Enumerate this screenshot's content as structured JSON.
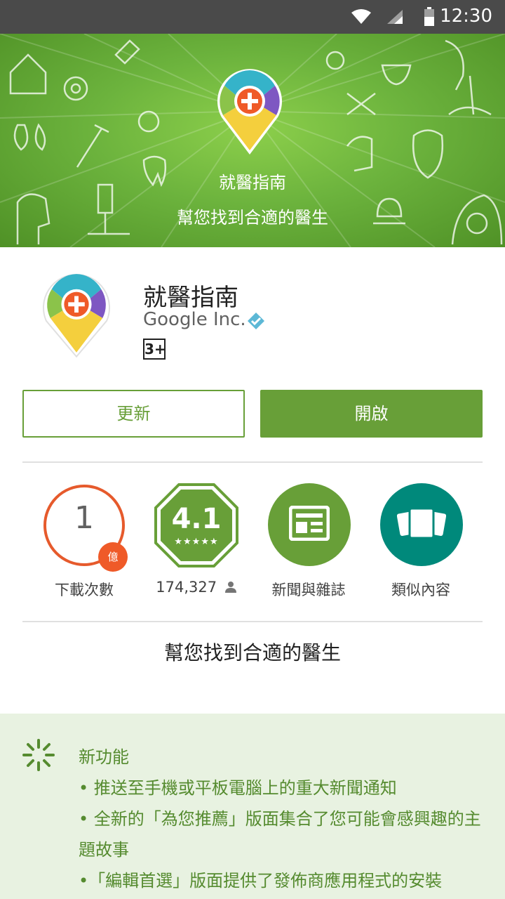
{
  "status_bar": {
    "time": "12:30"
  },
  "hero": {
    "title": "就醫指南",
    "subtitle": "幫您找到合適的醫生"
  },
  "app": {
    "name": "就醫指南",
    "developer": "Google Inc.",
    "content_rating": "3+"
  },
  "buttons": {
    "update": "更新",
    "open": "開啟"
  },
  "stats": {
    "downloads": {
      "value": "1",
      "unit": "億",
      "label": "下載次數"
    },
    "rating": {
      "value": "4.1",
      "stars": "★★★★★",
      "count": "174,327",
      "stars_value": 4.1
    },
    "category": {
      "label": "新聞與雜誌",
      "icon": "newspaper-icon"
    },
    "similar": {
      "label": "類似內容",
      "icon": "cards-icon"
    }
  },
  "tagline": "幫您找到合適的醫生",
  "whats_new": {
    "title": "新功能",
    "items": [
      "• 推送至手機或平板電腦上的重大新聞通知",
      "• 全新的「為您推薦」版面集合了您可能會感興趣的主題故事",
      "•「編輯首選」版面提供了發佈商應用程式的安裝"
    ]
  },
  "colors": {
    "accent": "#689f38",
    "downloads": "#e65a2c",
    "teal": "#00897b",
    "whats_new_bg": "#e8f2e1"
  }
}
